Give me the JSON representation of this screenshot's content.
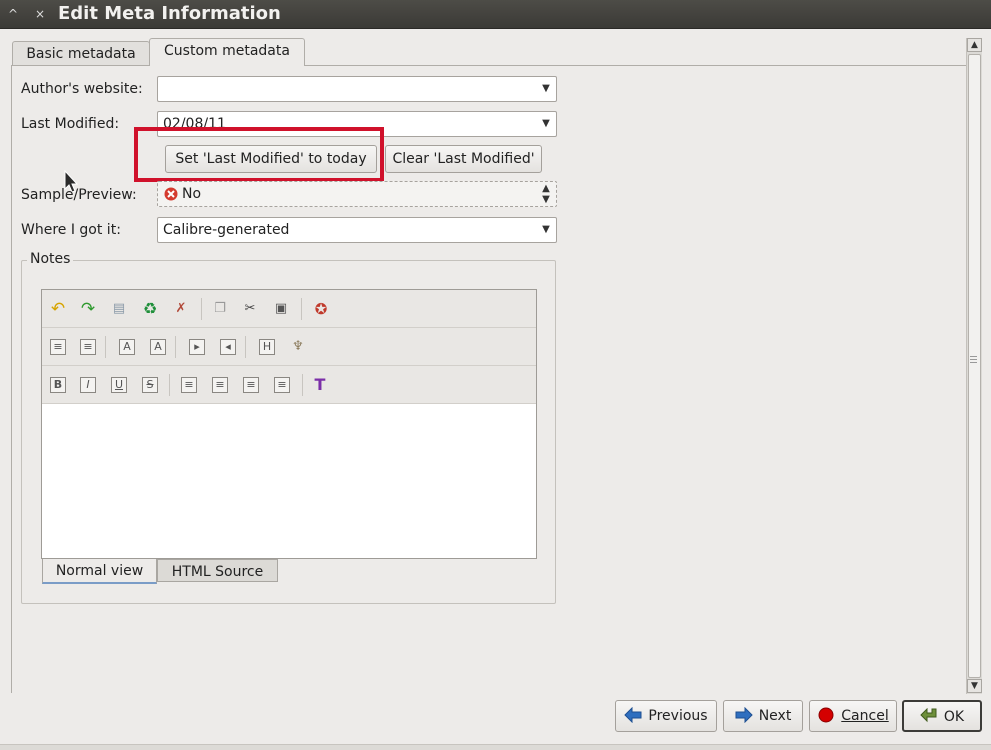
{
  "window": {
    "title": "Edit Meta Information",
    "controls": [
      "^",
      "×"
    ]
  },
  "tabs": [
    {
      "label": "Basic metadata",
      "active": false
    },
    {
      "label": "Custom metadata",
      "active": true
    }
  ],
  "form": {
    "authors_website": {
      "label": "Author's website:",
      "value": ""
    },
    "last_modified": {
      "label": "Last Modified:",
      "value": "02/08/11"
    },
    "set_today_label": "Set 'Last Modified' to today",
    "clear_label": "Clear 'Last Modified'",
    "sample_preview": {
      "label": "Sample/Preview:",
      "value": "No"
    },
    "where_got": {
      "label": "Where I got it:",
      "value": "Calibre-generated"
    }
  },
  "notes": {
    "group_label": "Notes",
    "toolbar_rows": [
      [
        "undo-icon",
        "redo-icon",
        "select-all-icon",
        "recycle-icon",
        "remove-format-icon",
        "copy-icon",
        "cut-icon",
        "paste-icon",
        "color-palette-icon"
      ],
      [
        "ordered-list-icon",
        "unordered-list-icon",
        "superscript-icon",
        "subscript-icon",
        "indent-icon",
        "outdent-icon",
        "heading-icon",
        "format-brush-icon"
      ],
      [
        "bold-icon",
        "italic-icon",
        "underline-icon",
        "strikethrough-icon",
        "align-left-icon",
        "align-center-icon",
        "align-right-icon",
        "justify-icon",
        "text-color-icon"
      ]
    ],
    "content": "",
    "view_tabs": [
      "Normal view",
      "HTML Source"
    ]
  },
  "buttons": {
    "previous": "Previous",
    "next": "Next",
    "cancel": "Cancel",
    "ok": "OK"
  },
  "colors": {
    "highlight": "#d0112b",
    "titlebar": "#3f3e3a",
    "nav_arrow": "#2f6fbf",
    "cancel_icon": "#d40000",
    "no_icon": "#d43a2e"
  }
}
